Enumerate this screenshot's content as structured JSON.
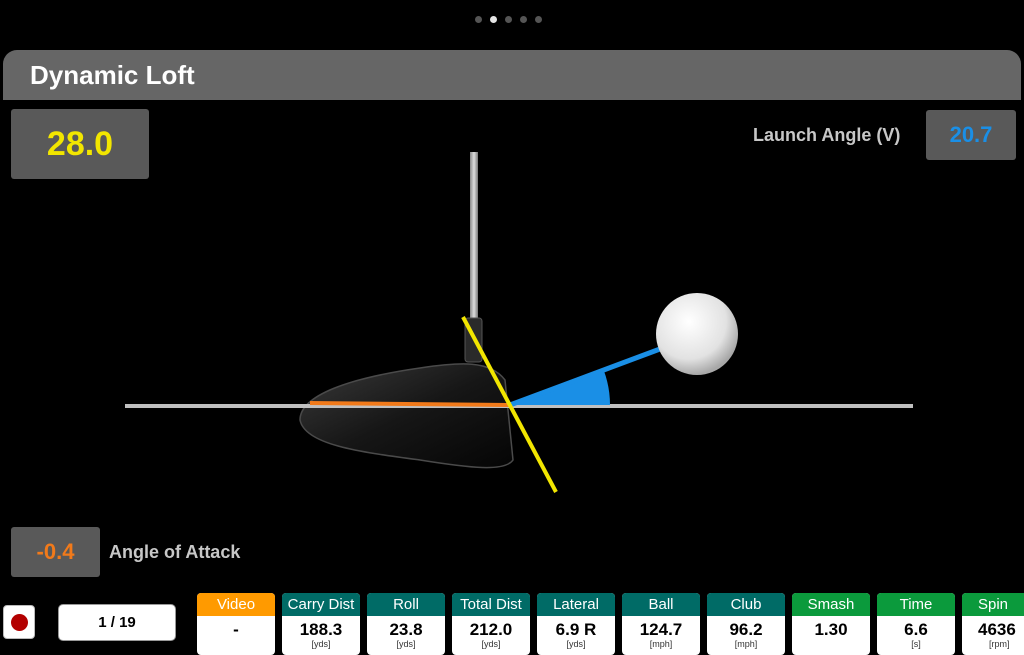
{
  "pager": {
    "count": 5,
    "active_index": 1
  },
  "header": {
    "title": "Dynamic Loft"
  },
  "dynamic_loft": {
    "value": "28.0",
    "color": "#f2e600"
  },
  "launch_angle": {
    "label": "Launch Angle (V)",
    "value": "20.7",
    "color": "#1a8fe6"
  },
  "angle_of_attack": {
    "label": "Angle of Attack",
    "value": "-0.4",
    "color": "#f27a1a"
  },
  "footer": {
    "page_indicator": "1 / 19",
    "metrics": [
      {
        "label": "Video",
        "value": "-",
        "unit": "",
        "color": "#ff9a00"
      },
      {
        "label": "Carry Dist",
        "value": "188.3",
        "unit": "[yds]",
        "color": "#006b66"
      },
      {
        "label": "Roll",
        "value": "23.8",
        "unit": "[yds]",
        "color": "#006b66"
      },
      {
        "label": "Total Dist",
        "value": "212.0",
        "unit": "[yds]",
        "color": "#006b66"
      },
      {
        "label": "Lateral",
        "value": "6.9 R",
        "unit": "[yds]",
        "color": "#006b66"
      },
      {
        "label": "Ball",
        "value": "124.7",
        "unit": "[mph]",
        "color": "#006b66"
      },
      {
        "label": "Club",
        "value": "96.2",
        "unit": "[mph]",
        "color": "#006b66"
      },
      {
        "label": "Smash",
        "value": "1.30",
        "unit": "",
        "color": "#0b9a3c"
      },
      {
        "label": "Time",
        "value": "6.6",
        "unit": "[s]",
        "color": "#0b9a3c"
      },
      {
        "label": "Spin",
        "value": "4636",
        "unit": "[rpm]",
        "color": "#0b9a3c"
      }
    ]
  }
}
